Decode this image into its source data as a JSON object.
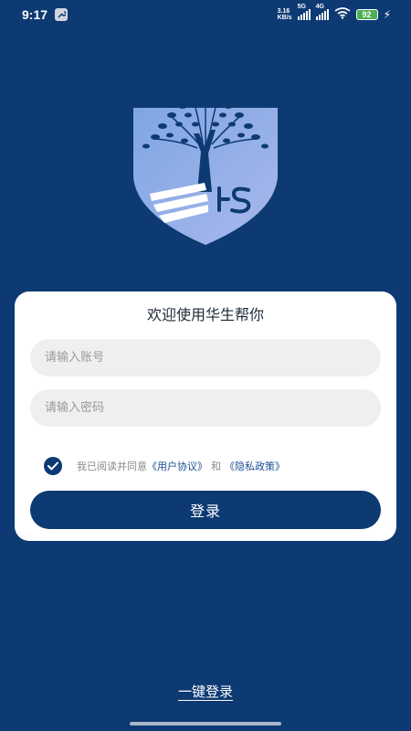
{
  "status_bar": {
    "time": "9:17",
    "net_speed_value": "3.16",
    "net_speed_unit": "KB/s",
    "signal_1_label": "5G",
    "signal_2_label": "4G",
    "battery_level": "92",
    "icons": [
      "wrench-icon",
      "signal-icon",
      "wifi-icon",
      "battery-icon",
      "charging-icon"
    ]
  },
  "logo": {
    "text": "HS"
  },
  "card": {
    "title": "欢迎使用华生帮你",
    "account_placeholder": "请输入账号",
    "account_value": "",
    "password_placeholder": "请输入密码",
    "password_value": "",
    "agreement_prefix": "我已阅读并同意",
    "user_agreement_link": "《用户协议》",
    "agreement_and": "和",
    "privacy_policy_link": "《隐私政策》",
    "agreement_checked": true,
    "login_label": "登录"
  },
  "one_click_login_label": "一键登录",
  "colors": {
    "background": "#0d3a73",
    "card": "#ffffff",
    "primary": "#0d3a73",
    "link": "#1c4f96",
    "field": "#efefef"
  }
}
